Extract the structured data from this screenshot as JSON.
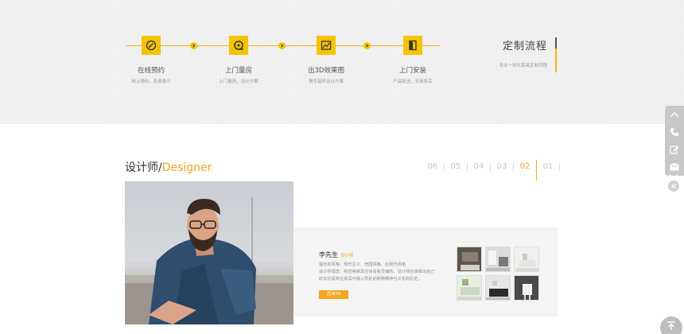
{
  "process": {
    "title": "定制流程",
    "subtitle": "专业一体化家具定制流程",
    "steps": [
      {
        "title": "在线预约",
        "sub": "网上预约，免费量尺",
        "icon": "pen-icon"
      },
      {
        "title": "上门量房",
        "sub": "上门量房，设计方案",
        "icon": "tape-measure-icon"
      },
      {
        "title": "出3D效果图",
        "sub": "预览最终设计方案",
        "icon": "image-icon"
      },
      {
        "title": "上门安装",
        "sub": "产品配送，安装售后",
        "icon": "door-icon"
      }
    ]
  },
  "designer": {
    "heading_cn": "设计师/",
    "heading_en": "Designer",
    "pager": [
      "06",
      "05",
      "04",
      "03",
      "02",
      "01"
    ],
    "active_page": "02",
    "name": "李先生",
    "role": "设计师",
    "desc": "擅长的风格：现代主义、田园风格、后现代风格\n设计师理念：我觉得家具应该是有灵魂的，设计师应该做出自己的文化是将在家具中融入所处的那种精神与文化的历史，",
    "consult_label": "咨询TA"
  },
  "colors": {
    "accent": "#f5a623",
    "yellow": "#f5c400"
  }
}
